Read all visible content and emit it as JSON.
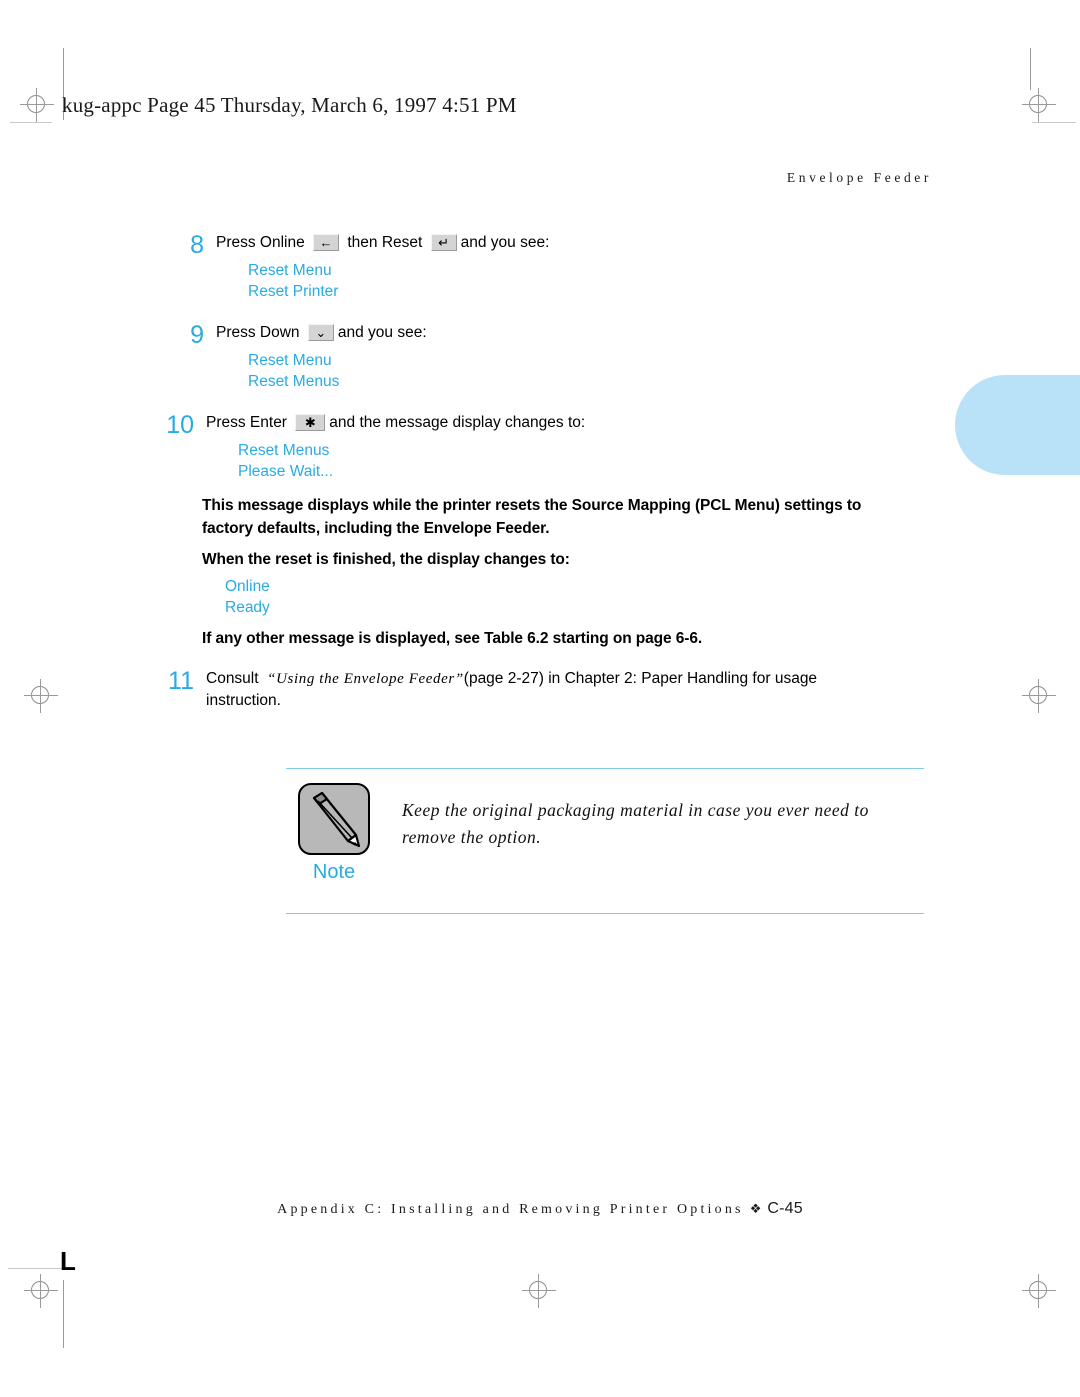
{
  "document": {
    "file_header": "kug-appc  Page 45  Thursday, March 6, 1997  4:51 PM",
    "running_head": "Envelope Feeder",
    "footer_text": "Appendix C: Installing and Removing Printer Options",
    "footer_diamond": "❖",
    "footer_page": "C-45",
    "corner_mark": "L",
    "accent_color": "#29ABE2",
    "tab_color": "#b9e2f8"
  },
  "steps": [
    {
      "number": "8",
      "segments": [
        {
          "type": "text",
          "value": "Press Online "
        },
        {
          "type": "key",
          "value": "←",
          "name": "online-key"
        },
        {
          "type": "text",
          "value": " then Reset "
        },
        {
          "type": "key",
          "value": "↵",
          "name": "reset-key"
        },
        {
          "type": "text",
          "value": "and you see:"
        }
      ],
      "display": [
        "Reset Menu",
        "Reset Printer"
      ]
    },
    {
      "number": "9",
      "segments": [
        {
          "type": "text",
          "value": "Press Down "
        },
        {
          "type": "key",
          "value": "⌄",
          "name": "down-key"
        },
        {
          "type": "text",
          "value": "and you see:"
        }
      ],
      "display": [
        "Reset Menu",
        "Reset Menus"
      ]
    },
    {
      "number": "10",
      "segments": [
        {
          "type": "text",
          "value": "Press Enter "
        },
        {
          "type": "key",
          "value": "✱",
          "name": "enter-key"
        },
        {
          "type": "text",
          "value": "and the message display changes to:"
        }
      ],
      "display": [
        "Reset Menus",
        "Please Wait..."
      ]
    }
  ],
  "notes": {
    "reset_description_line1": "This message displays while the printer resets the Source Mapping (PCL Menu) settings to",
    "reset_description_line2": "factory defaults, including the Envelope Feeder.",
    "finished_heading": "When the reset is finished, the display changes to:",
    "finished_display": [
      "Online",
      "Ready"
    ],
    "other_message": "If any other message is displayed, see Table 6.2 starting on page 6-6."
  },
  "step11": {
    "number": "11",
    "prefix": "Consult  ",
    "quote_open": "“",
    "title": "Using the Envelope Feeder",
    "quote_close": "”",
    "suffix": "(page 2-27) in Chapter 2: Paper Handling for usage",
    "line2": "instruction."
  },
  "note_box": {
    "label": "Note",
    "icon": "pencil-icon",
    "text_line1": "Keep the original packaging material in case you ever need to",
    "text_line2": "remove the option."
  }
}
